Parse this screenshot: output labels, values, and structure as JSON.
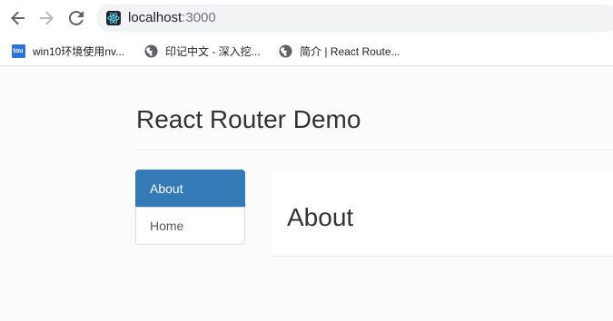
{
  "browser": {
    "url_host": "localhost",
    "url_port": ":3000",
    "favicon": "react-favicon",
    "nav_icons": [
      "back-arrow-icon",
      "forward-arrow-icon",
      "reload-icon"
    ]
  },
  "bookmarks": [
    {
      "label": "win10环境使用nv...",
      "icon": "tou-icon",
      "icon_text": "tou"
    },
    {
      "label": "印记中文 - 深入挖...",
      "icon": "globe-icon"
    },
    {
      "label": "简介 | React Route...",
      "icon": "globe-icon"
    }
  ],
  "page": {
    "title": "React Router Demo",
    "nav": [
      {
        "label": "About",
        "active": true
      },
      {
        "label": "Home",
        "active": false
      }
    ],
    "content_title": "About"
  },
  "colors": {
    "accent": "#337ab7",
    "page_background": "#fbfbfb"
  }
}
